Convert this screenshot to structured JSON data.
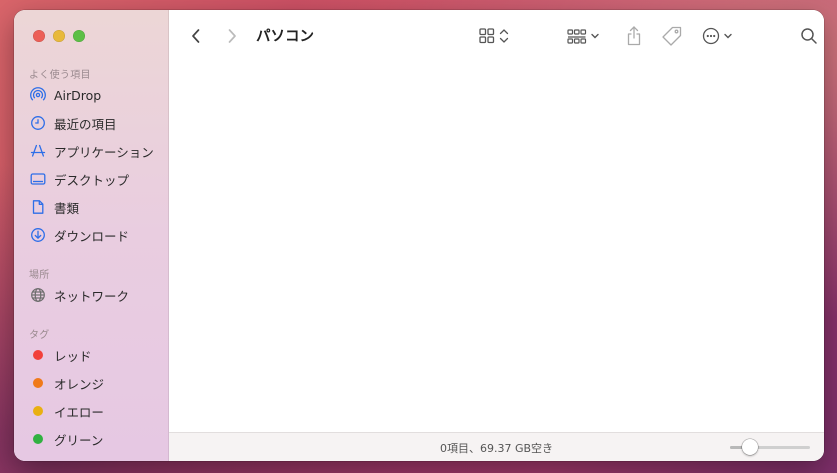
{
  "window": {
    "title": "パソコン"
  },
  "sidebar": {
    "favorites_title": "よく使う項目",
    "favorites": [
      {
        "label": "AirDrop",
        "icon": "airdrop-icon"
      },
      {
        "label": "最近の項目",
        "icon": "clock-icon"
      },
      {
        "label": "アプリケーション",
        "icon": "applications-icon"
      },
      {
        "label": "デスクトップ",
        "icon": "desktop-icon"
      },
      {
        "label": "書類",
        "icon": "document-icon"
      },
      {
        "label": "ダウンロード",
        "icon": "download-icon"
      }
    ],
    "locations_title": "場所",
    "locations": [
      {
        "label": "ネットワーク",
        "icon": "globe-icon"
      }
    ],
    "tags_title": "タグ",
    "tags": [
      {
        "label": "レッド",
        "color": "#f2403b"
      },
      {
        "label": "オレンジ",
        "color": "#f07a1a"
      },
      {
        "label": "イエロー",
        "color": "#e9b012"
      },
      {
        "label": "グリーン",
        "color": "#31b141"
      }
    ]
  },
  "toolbar": {
    "back_icon": "chevron-left-icon",
    "forward_icon": "chevron-right-icon",
    "view_icon": "icon-grid-icon",
    "group_icon": "group-grid-icon",
    "share_icon": "share-icon",
    "tag_icon": "tag-icon",
    "action_icon": "ellipsis-circle-icon",
    "search_icon": "search-icon"
  },
  "status": {
    "text": "0項目、69.37 GB空き",
    "zoom_level": 0.25
  },
  "colors": {
    "accent": "#1a6ff0",
    "sidebar_icon": "#2d6ee8"
  }
}
